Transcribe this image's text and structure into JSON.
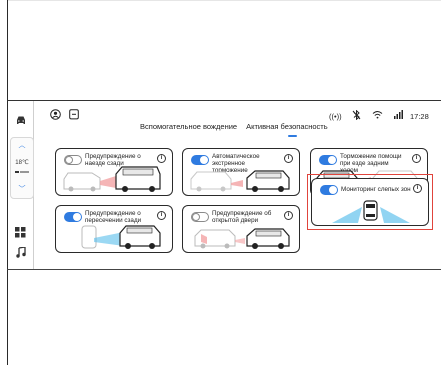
{
  "colors": {
    "accent": "#2f7be0",
    "alert_red": "#e0443c",
    "radar_blue": "#48b8ea"
  },
  "status_bar": {
    "left_icons": [
      "user-circle-icon",
      "message-square-icon"
    ],
    "right_icons": [
      "radar-signal-icon",
      "bluetooth-off-icon",
      "wifi-icon",
      "cellular-signal-icon"
    ],
    "time": "17:28"
  },
  "dock": {
    "items": [
      "car-front-icon",
      "car-side-icon",
      "climate-control",
      "apps-icon",
      "music-icon"
    ],
    "temperature": "18℃"
  },
  "tabs": [
    {
      "label": "Вспомогательное вождение",
      "active": false
    },
    {
      "label": "Активная безопасность",
      "active": true
    }
  ],
  "cards": [
    {
      "title": "Предупреждение о наезде сзади",
      "enabled": false,
      "info": "i"
    },
    {
      "title": "Автоматическое экстренное торможение",
      "enabled": true,
      "info": "i"
    },
    {
      "title": "Торможение помощи при езде задним ходом",
      "enabled": true,
      "info": "i"
    },
    {
      "title": "Предупреждение о пересечении сзади",
      "enabled": true,
      "info": "i"
    },
    {
      "title": "Предупреждение об открытой двери",
      "enabled": false,
      "info": "i"
    },
    {
      "title": "Мониторинг слепых зон",
      "enabled": true,
      "info": "i",
      "highlighted": true
    }
  ]
}
